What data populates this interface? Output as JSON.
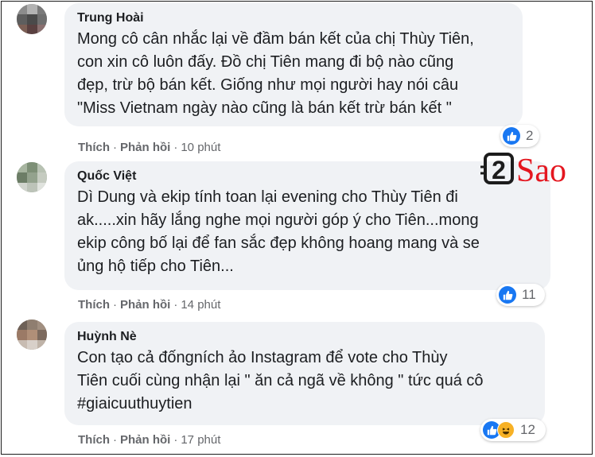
{
  "comments": [
    {
      "author": "Trung Hoài",
      "text": "Mong cô cân nhắc lại về đầm bán kết của chị Thùy Tiên,\ncon xin cô luôn đấy. Đồ chị Tiên mang đi bộ nào cũng\nđẹp, trừ bộ bán kết. Giống như mọi người hay nói câu\n\"Miss Vietnam ngày nào cũng là bán kết trừ bán kết \"",
      "like_label": "Thích",
      "reply_label": "Phản hồi",
      "time": "10 phút",
      "reaction_count": "2"
    },
    {
      "author": "Quốc Việt",
      "text": "Dì Dung và ekip tính toan lại evening cho Thùy Tiên đi\nak.....xin hãy lắng nghe mọi người góp ý cho Tiên...mong\nekip công bố lại để fan sắc đẹp không hoang mang và se\nủng hộ tiếp cho Tiên...",
      "like_label": "Thích",
      "reply_label": "Phản hồi",
      "time": "14 phút",
      "reaction_count": "11"
    },
    {
      "author": "Huỳnh Nè",
      "text": "Con tạo cả đốngních ảo Instagram để vote cho Thùy\nTiên cuối cùng nhận lại \" ăn cả ngã về không \" tức quá cô\n#giaicuuthuytien",
      "like_label": "Thích",
      "reply_label": "Phản hồi",
      "time": "17 phút",
      "reaction_count": "12"
    }
  ],
  "separator": "·",
  "watermark": {
    "number": "2",
    "word": "Sao"
  },
  "colors": {
    "accent": "#1877f2",
    "bubble": "#f0f2f5",
    "meta": "#65676b",
    "haha": "#f7b125",
    "logo": "#e4161f"
  },
  "icons": [
    "like-icon",
    "haha-icon"
  ]
}
